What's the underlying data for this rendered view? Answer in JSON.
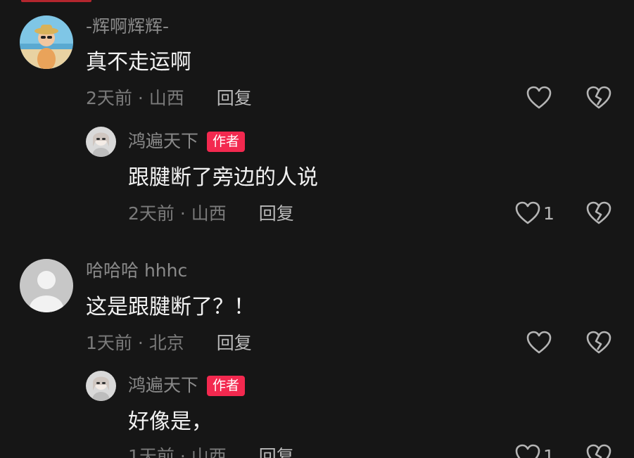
{
  "comments": [
    {
      "username": "-辉啊辉辉-",
      "text": "真不走运啊",
      "time": "2天前",
      "location": "山西",
      "reply_label": "回复",
      "likes": ""
    },
    {
      "username": "鸿遍天下",
      "badge": "作者",
      "text": "跟腱断了旁边的人说",
      "time": "2天前",
      "location": "山西",
      "reply_label": "回复",
      "likes": "1"
    },
    {
      "username": "哈哈哈 hhhc",
      "text": "这是跟腱断了？！",
      "time": "1天前",
      "location": "北京",
      "reply_label": "回复",
      "likes": ""
    },
    {
      "username": "鸿遍天下",
      "badge": "作者",
      "text": "好像是，",
      "time": "1天前",
      "location": "山西",
      "reply_label": "回复",
      "likes": "1"
    }
  ],
  "meta_separator": "·",
  "icons": {
    "like": "heart-outline-icon",
    "dislike": "broken-heart-icon"
  },
  "colors": {
    "background": "#161616",
    "author_badge": "#f3294f",
    "text_primary": "#f2f2f2",
    "text_secondary": "#8a8a8a"
  }
}
